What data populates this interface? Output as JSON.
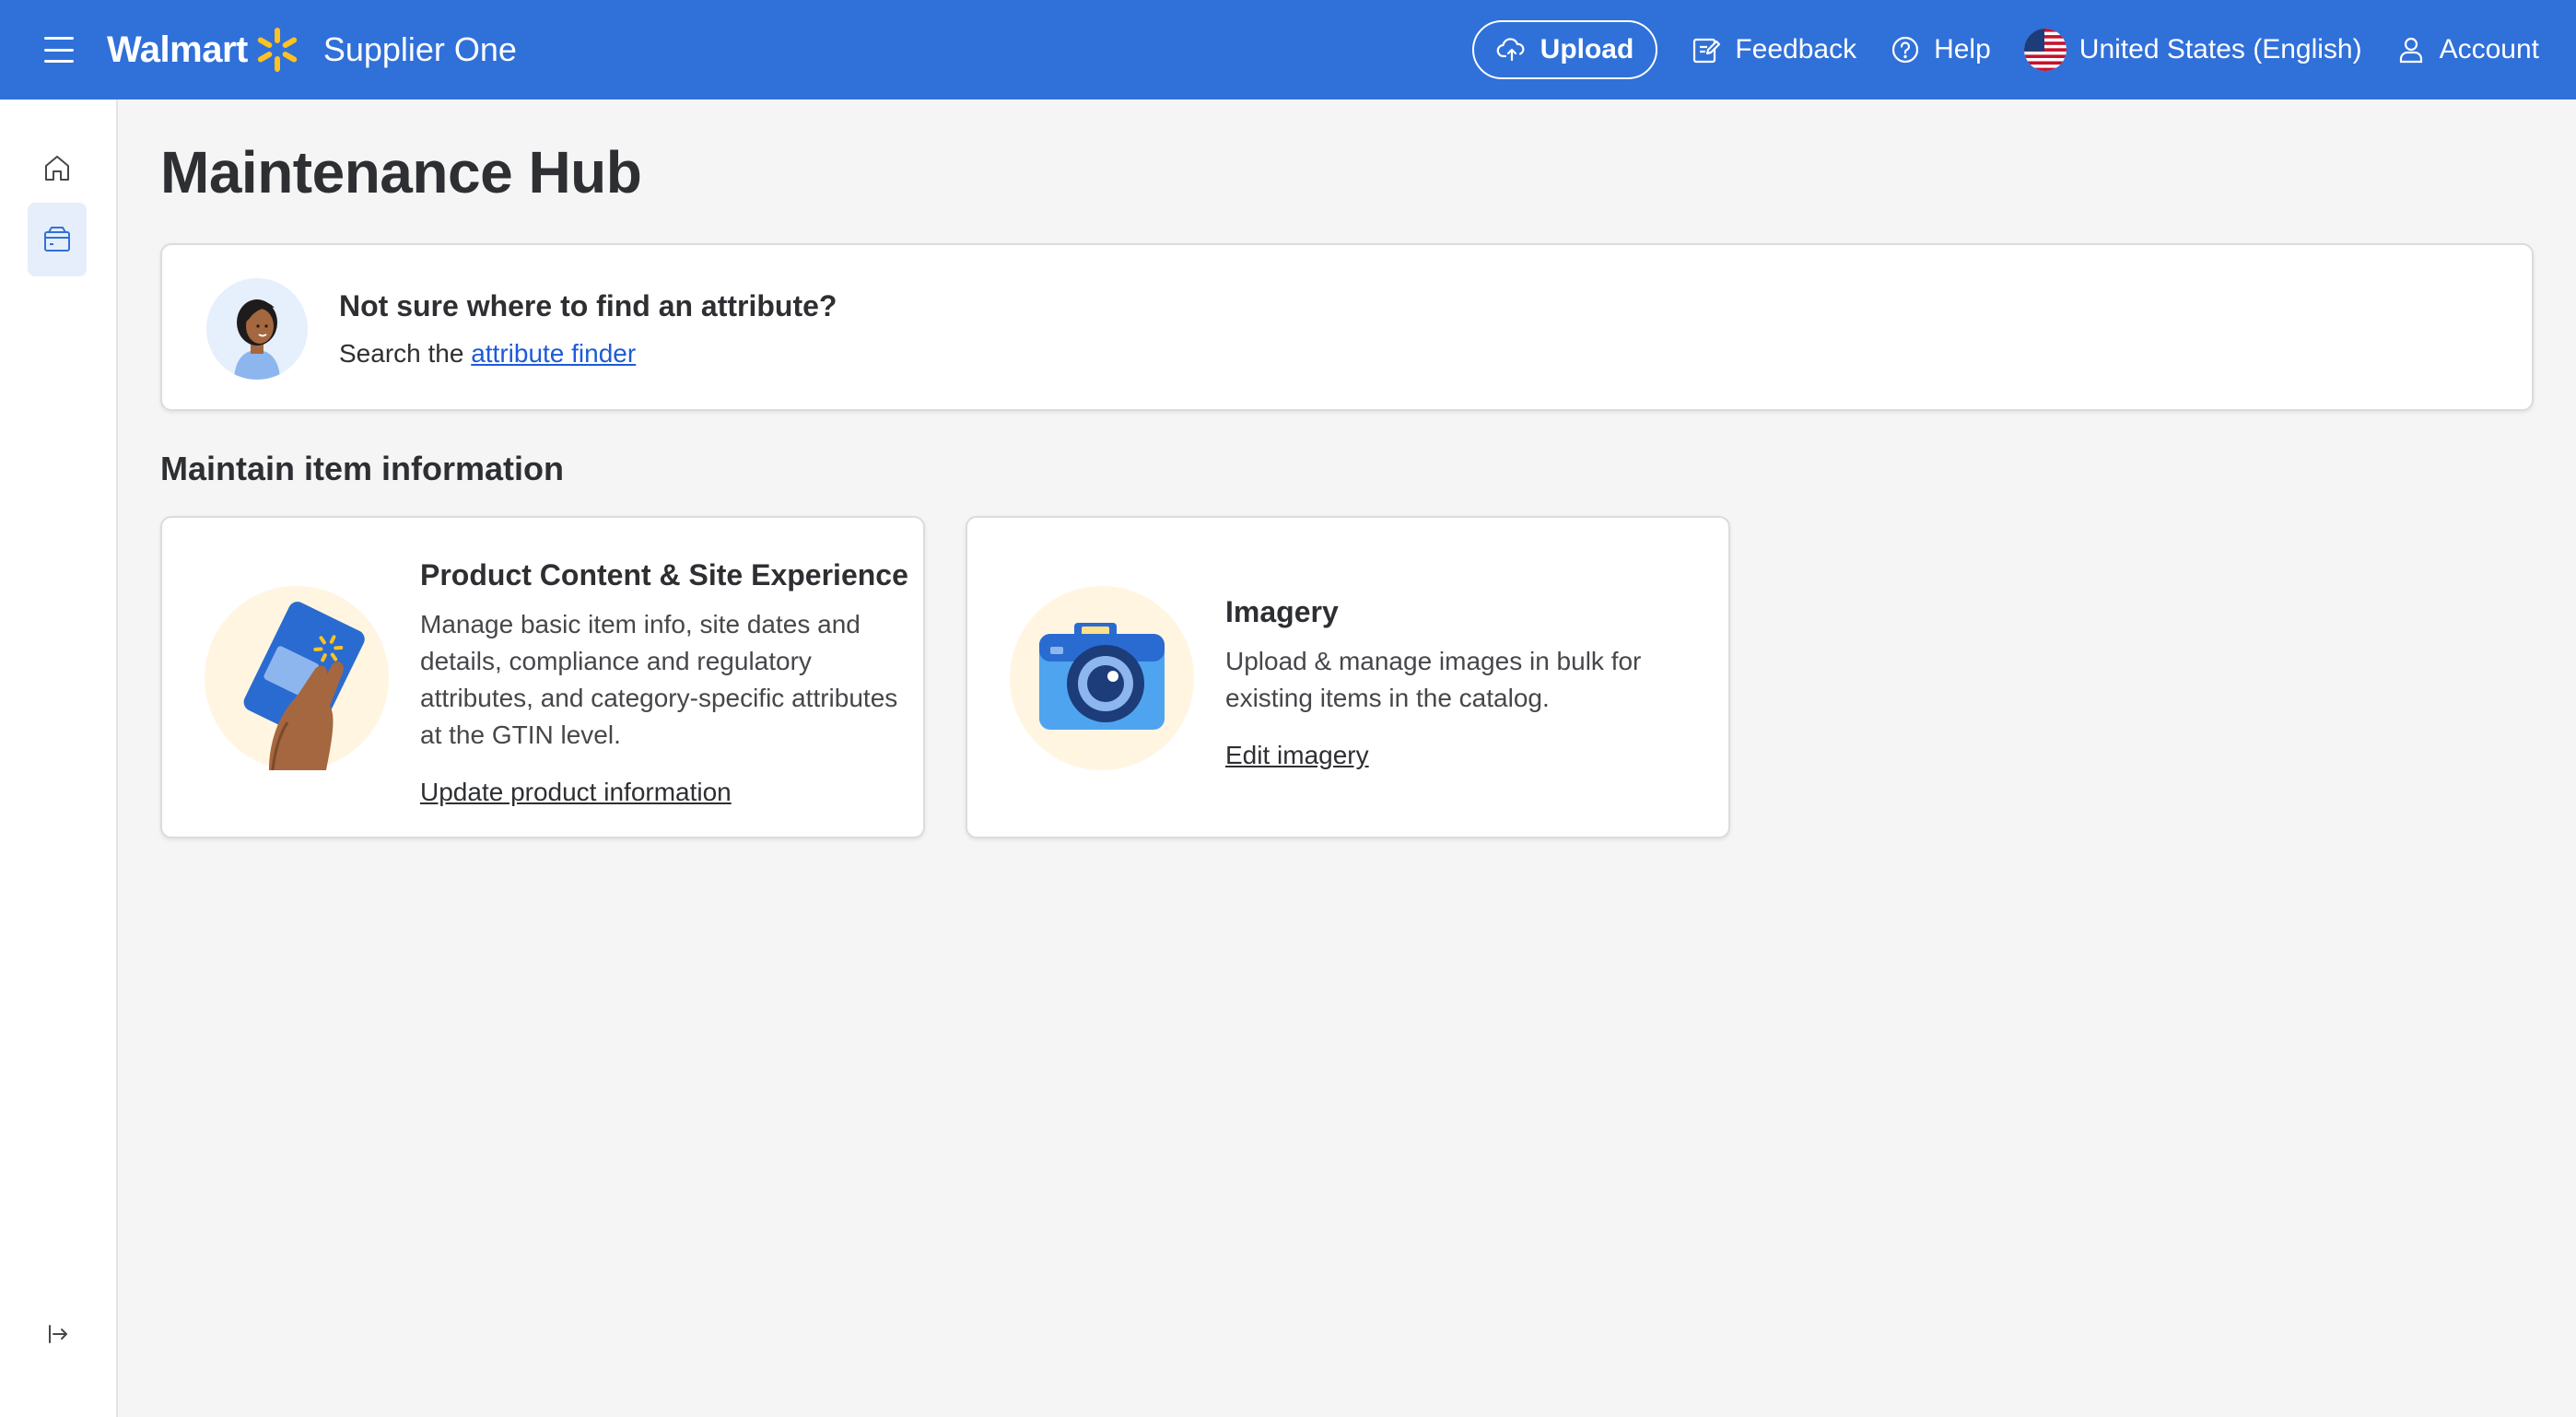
{
  "header": {
    "brand": "Walmart",
    "product": "Supplier One",
    "upload_label": "Upload",
    "feedback_label": "Feedback",
    "help_label": "Help",
    "locale_label": "United States (English)",
    "account_label": "Account"
  },
  "page": {
    "title": "Maintenance Hub"
  },
  "finder": {
    "title": "Not sure where to find an attribute?",
    "text_prefix": "Search the ",
    "link": "attribute finder"
  },
  "section": {
    "title": "Maintain item information"
  },
  "tiles": [
    {
      "title": "Product Content & Site Experience",
      "description": "Manage basic item info, site dates and details, compliance and regulatory attributes, and category-specific attributes at the GTIN level.",
      "link": "Update product information"
    },
    {
      "title": "Imagery",
      "description": "Upload & manage images in bulk for existing items in the catalog.",
      "link": "Edit imagery"
    }
  ],
  "colors": {
    "header_bg": "#3070d9",
    "spark": "#ffc220",
    "link": "#1d5bd6"
  }
}
